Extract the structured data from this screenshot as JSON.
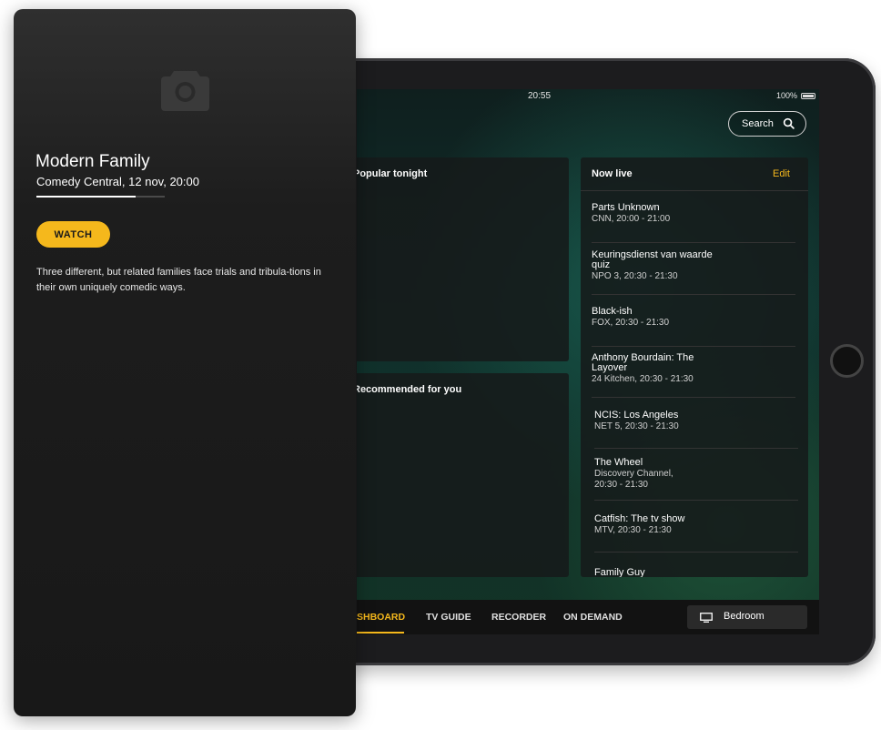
{
  "status_bar": {
    "time": "20:55",
    "battery": "100%"
  },
  "search": {
    "label": "Search"
  },
  "sections": {
    "popular": "Popular tonight",
    "recommended": "Recommended for you"
  },
  "now_live": {
    "title": "Now live",
    "edit": "Edit",
    "items": [
      {
        "name": "Parts Unknown",
        "sub": "CNN, 20:00 - 21:00"
      },
      {
        "name": "Keuringsdienst van waarde quiz",
        "sub": "NPO 3, 20:30 - 21:30"
      },
      {
        "name": "Black-ish",
        "sub": "FOX, 20:30 - 21:30"
      },
      {
        "name": "Anthony Bourdain: The Layover",
        "sub": "24 Kitchen, 20:30 - 21:30"
      },
      {
        "name": "NCIS: Los Angeles",
        "sub": "NET 5, 20:30 - 21:30"
      },
      {
        "name": "The Wheel",
        "sub": "Discovery Channel, 20:30 - 21:30"
      },
      {
        "name": "Catfish: The tv show",
        "sub": "MTV, 20:30 - 21:30"
      },
      {
        "name": "Family Guy",
        "sub": ""
      }
    ]
  },
  "nav": {
    "dashboard": "SHBOARD",
    "tv_guide": "TV GUIDE",
    "recorder": "RECORDER",
    "on_demand": "ON DEMAND",
    "device": "Bedroom"
  },
  "detail": {
    "title": "Modern Family",
    "meta": "Comedy Central, 12 nov, 20:00",
    "progress": 0.77,
    "watch": "WATCH",
    "description": "Three different, but related families face trials and tribula-tions in their own uniquely comedic ways."
  },
  "colors": {
    "accent": "#f5b81c",
    "card_bg": "#181818",
    "panel_bg": "#161a1a"
  },
  "icons": [
    "camera-icon",
    "search-icon",
    "tv-icon",
    "battery-icon",
    "home-button"
  ]
}
